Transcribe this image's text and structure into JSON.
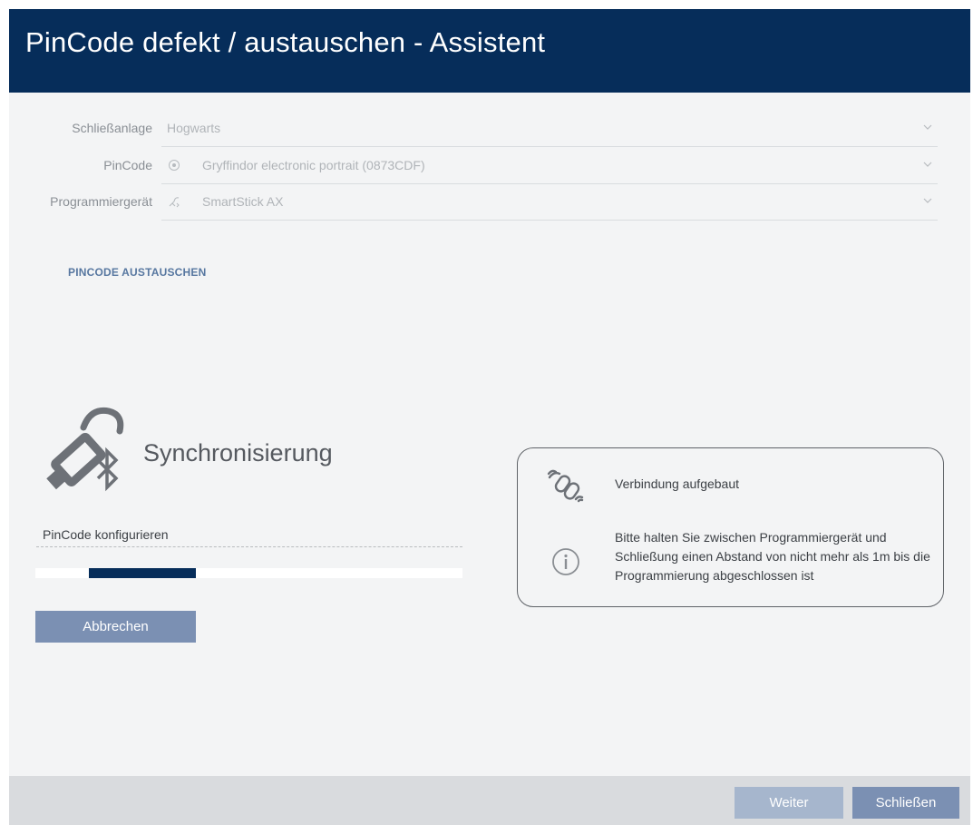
{
  "window": {
    "title": "PinCode defekt / austauschen - Assistent"
  },
  "fields": [
    {
      "label": "Schließanlage",
      "value": "Hogwarts",
      "icon": null
    },
    {
      "label": "PinCode",
      "value": "Gryffindor electronic portrait (0873CDF)",
      "icon": "pincode-icon"
    },
    {
      "label": "Programmiergerät",
      "value": "SmartStick AX",
      "icon": "smartstick-icon"
    }
  ],
  "section": {
    "heading": "PINCODE AUSTAUSCHEN"
  },
  "sync": {
    "icon": "bluetooth-stick-icon",
    "title": "Synchronisierung",
    "step_label": "PinCode konfigurieren",
    "progress": {
      "start": 0.125,
      "end": 0.375
    },
    "cancel_label": "Abbrechen"
  },
  "info": {
    "connection_icon": "connection-link-icon",
    "connection_text": "Verbindung aufgebaut",
    "hint_icon": "info-icon",
    "hint_text": "Bitte halten Sie zwischen Programmiergerät und Schließung einen Abstand von nicht mehr als 1m bis die Programmierung abgeschlossen ist"
  },
  "footer": {
    "next_label": "Weiter",
    "close_label": "Schließen"
  },
  "colors": {
    "titlebar": "#062d5a",
    "primary_button": "#7b90b3",
    "disabled_button": "#a6b6cd",
    "progress_fill": "#062d5a"
  }
}
